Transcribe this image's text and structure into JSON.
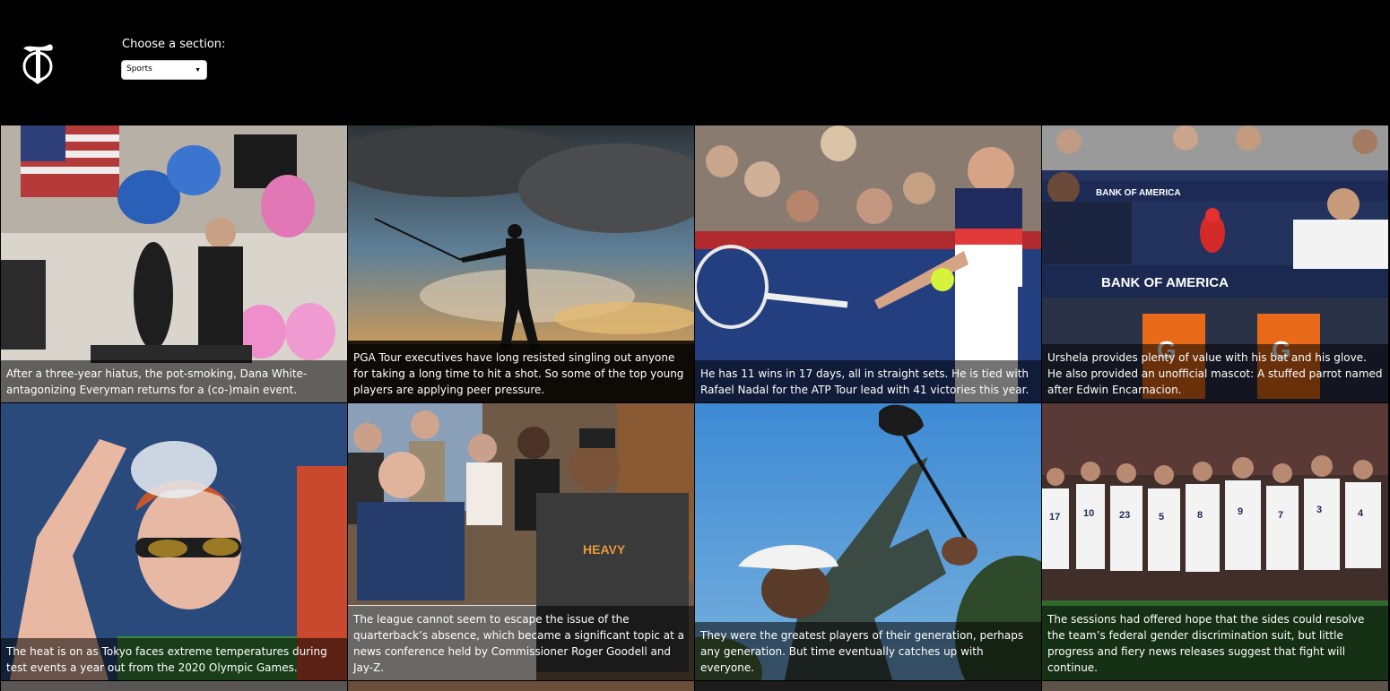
{
  "header": {
    "logo_letter": "T",
    "section_label": "Choose a section:",
    "section_value": "Sports"
  },
  "articles": [
    {
      "caption": "After a three-year hiatus, the pot-smoking, Dana White-antagonizing Everyman returns for a (co-)main event."
    },
    {
      "caption": "PGA Tour executives have long resisted singling out anyone for taking a long time to hit a shot. So some of the top young players are applying peer pressure."
    },
    {
      "caption": "He has 11 wins in 17 days, all in straight sets. He is tied with Rafael Nadal for the ATP Tour lead with 41 victories this year."
    },
    {
      "caption": "Urshela provides plenty of value with his bat and his glove. He also provided an unofficial mascot: A stuffed parrot named after Edwin Encarnacion."
    },
    {
      "caption": "The heat is on as Tokyo faces extreme temperatures during test events a year out from the 2020 Olympic Games."
    },
    {
      "caption": "The league cannot seem to escape the issue of the quarterback’s absence, which became a significant topic at a news conference held by Commissioner Roger Goodell and Jay-Z."
    },
    {
      "caption": "They were the greatest players of their generation, perhaps any generation. But time eventually catches up with everyone."
    },
    {
      "caption": "The sessions had offered hope that the sides could resolve the team’s federal gender discrimination suit, but little progress and fiery news releases suggest that fight will continue."
    }
  ],
  "images": {
    "boxing_flag_text": "",
    "dugout_sign": "BANK OF AMERICA",
    "shirt_text": "HEAVY",
    "jersey_numbers": [
      "17",
      "10",
      "23",
      "5",
      "8",
      "9",
      "7",
      "3",
      "4"
    ]
  },
  "colors": {
    "background": "#000000",
    "caption_overlay": "rgba(0,0,0,0.55)"
  },
  "icons": {
    "logo": "nyt-logo-icon",
    "select_chevron": "chevron-down-icon"
  }
}
